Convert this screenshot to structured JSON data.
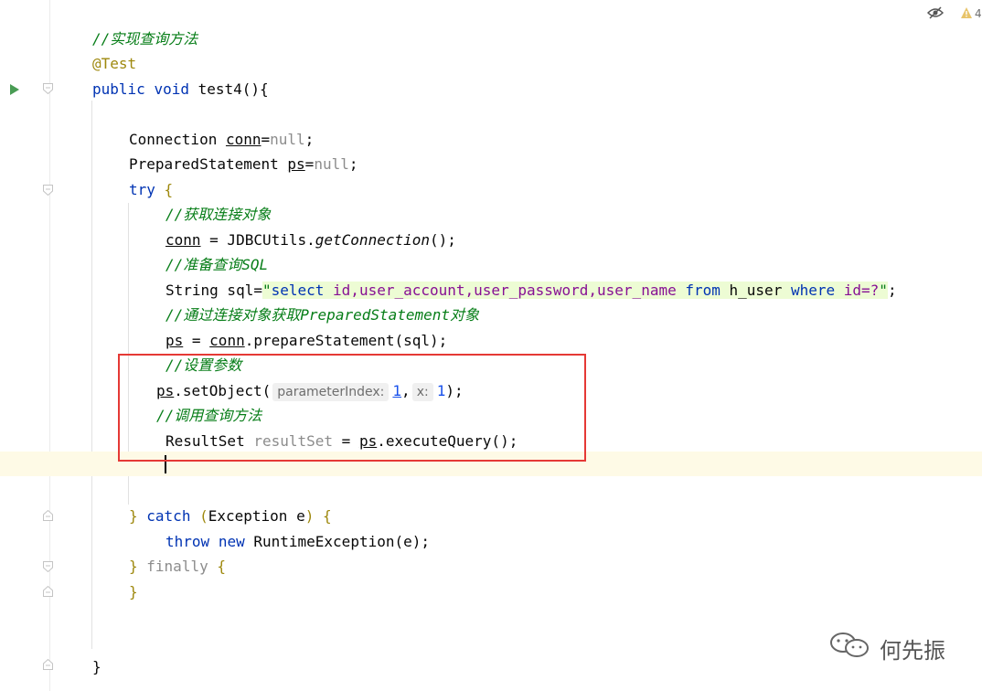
{
  "editor": {
    "lines": {
      "comment_query_method": "//实现查询方法",
      "annotation": "@Test",
      "method_public": "public",
      "method_void": "void",
      "method_sig": "test4(){",
      "conn_type": "Connection",
      "conn_var": "conn",
      "conn_eq": "=",
      "null1": "null",
      "semi1": ";",
      "ps_type": "PreparedStatement",
      "ps_var": "ps",
      "ps_eq": "=",
      "null2": "null",
      "semi2": ";",
      "try_kw": "try",
      "try_brace": "{",
      "comment_get_conn": "//获取连接对象",
      "conn_assign_var": "conn",
      "conn_assign_rest": " = JDBCUtils.",
      "get_connection": "getConnection",
      "conn_assign_end": "();",
      "comment_prepare_sql": "//准备查询SQL",
      "string_decl": "String sql=",
      "quote_open": "\"",
      "sql_select": "select",
      "sql_cols": " id,user_account,user_password,user_name ",
      "sql_from": "from",
      "sql_table": " h_user ",
      "sql_where": "where",
      "sql_cond": " id=?",
      "quote_close": "\"",
      "semi3": ";",
      "comment_get_ps": "//通过连接对象获取",
      "comment_get_ps_ital": "PreparedStatement",
      "comment_get_ps_end": "对象",
      "ps_assign_var": "ps",
      "ps_assign_eq": " = ",
      "ps_assign_conn": "conn",
      "ps_assign_rest": ".prepareStatement(sql);",
      "comment_set_params": "//设置参数",
      "setobj_var": "ps",
      "setobj_call": ".setObject(",
      "hint_param_index": "parameterIndex:",
      "arg1": "1",
      "comma": ",",
      "hint_x": "x:",
      "arg2": "1",
      "setobj_end": ");",
      "comment_call_query": "//调用查询方法",
      "rs_type": "ResultSet ",
      "rs_var": "resultSet",
      "rs_eq": " = ",
      "rs_ps": "ps",
      "rs_call": ".executeQuery();",
      "catch_close": "}",
      "catch_kw": "catch",
      "catch_open_paren": "(",
      "catch_param": "Exception e",
      "catch_close_paren": ")",
      "catch_brace": "{",
      "throw_kw": "throw",
      "new_kw": "new",
      "throw_rest": " RuntimeException(e);",
      "finally_close": "}",
      "finally_kw": "finally",
      "finally_brace": "{",
      "finally_end": "}",
      "method_end": "}"
    },
    "warning_count": "4"
  },
  "watermark": {
    "text": "何先振"
  },
  "icons": [
    "run-icon",
    "fold-icon",
    "eye-off-icon",
    "warning-icon",
    "wechat-icon"
  ],
  "colors": {
    "keyword": "#0033b3",
    "comment": "#8c8c8c",
    "annotation": "#9e880d",
    "string": "#067d17",
    "highlight": "#e53935"
  }
}
